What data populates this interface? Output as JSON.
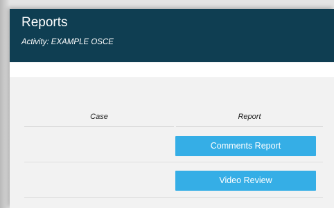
{
  "header": {
    "title": "Reports",
    "activity_line": "Activity: EXAMPLE OSCE"
  },
  "table": {
    "columns": [
      "Case",
      "Report"
    ],
    "rows": [
      {
        "case": "",
        "report_button": "Comments Report"
      },
      {
        "case": "",
        "report_button": "Video Review"
      }
    ]
  },
  "colors": {
    "header_bg": "#0f3e52",
    "button_bg": "#35aee6",
    "table_bg": "#f2f2f2"
  }
}
